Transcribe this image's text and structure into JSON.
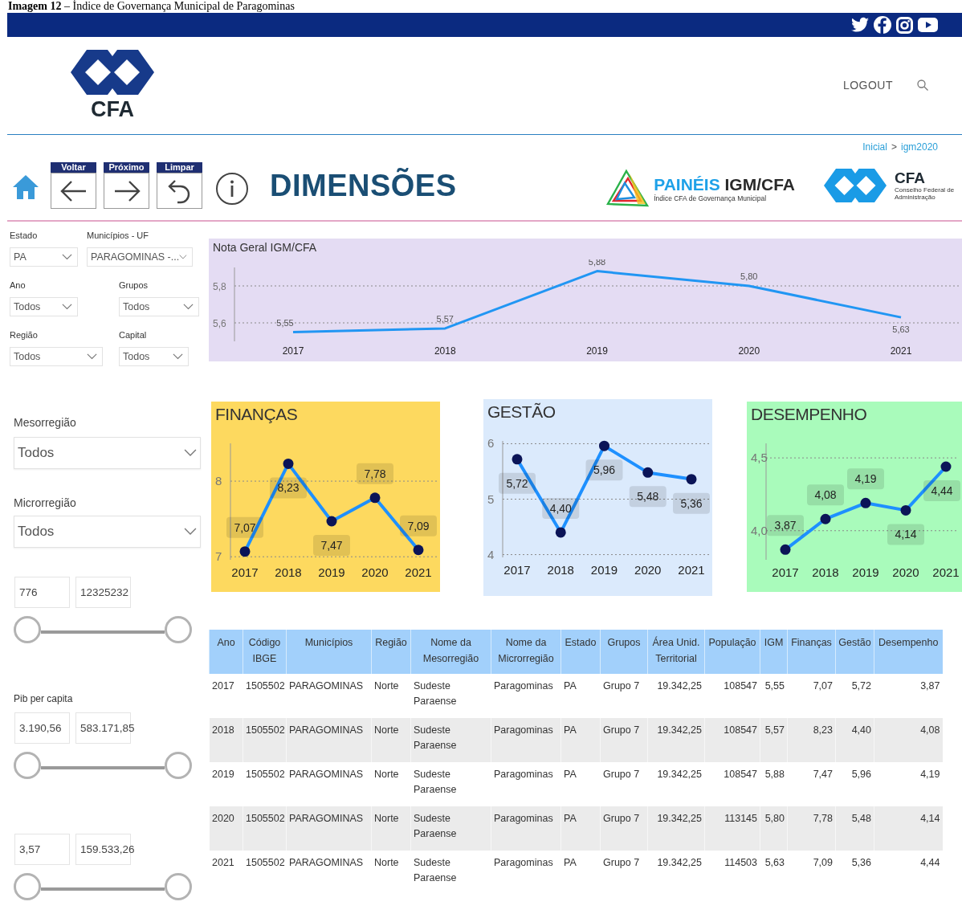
{
  "caption": "**Imagem 12** – Índice de Governança Municipal de Paragominas",
  "header": {
    "logo_text": "CFA",
    "links": [
      "LOGOUT"
    ]
  },
  "breadcrumb": {
    "items": [
      "Inicial",
      "igm2020"
    ],
    "separator": ">"
  },
  "toolbar": {
    "buttons": [
      {
        "label": "Voltar",
        "kind": "back"
      },
      {
        "label": "Próximo",
        "kind": "forward"
      },
      {
        "label": "Limpar",
        "kind": "reset"
      }
    ],
    "title": "DIMENSÕES",
    "brand": {
      "accent": "PAINÉIS",
      "name": "IGM/CFA",
      "subtitle": "Índice CFA de Governança Municipal"
    },
    "org": {
      "name": "CFA",
      "subtitle": "Conselho Federal de Administração"
    }
  },
  "filters": [
    {
      "label": "Estado",
      "value": "PA"
    },
    {
      "label": "Municípios - UF",
      "value": "PARAGOMINAS -..."
    },
    {
      "label": "Ano",
      "value": "Todos"
    },
    {
      "label": "Grupos",
      "value": "Todos"
    },
    {
      "label": "Região",
      "value": "Todos"
    },
    {
      "label": "Capital",
      "value": "Todos"
    }
  ],
  "large_filters": [
    {
      "label": "Mesorregião",
      "value": "Todos"
    },
    {
      "label": "Microrregião",
      "value": "Todos"
    }
  ],
  "ranges": [
    {
      "min": "776",
      "max": "12325232"
    },
    {
      "label": "Pib per capita",
      "min": "3.190,56",
      "max": "583.171,85"
    },
    {
      "min": "3,57",
      "max": "159.533,26"
    }
  ],
  "overall_chart": {
    "title": "Nota Geral IGM/CFA",
    "chart_data": {
      "type": "line",
      "categories": [
        "2017",
        "2018",
        "2019",
        "2020",
        "2021"
      ],
      "values": [
        5.55,
        5.57,
        5.88,
        5.8,
        5.63
      ],
      "ylim": [
        5.5,
        5.9
      ],
      "grid": true,
      "yticks": [
        {
          "value": 5.6,
          "label": "5,6"
        },
        {
          "value": 5.8,
          "label": "5,8"
        }
      ],
      "value_labels": [
        "5,55",
        "5,57",
        "5,88",
        "5,80",
        "5,63"
      ]
    }
  },
  "dimension_charts": [
    {
      "title": "FINANÇAS",
      "color": "#fdd95f",
      "chart_data": {
        "type": "line",
        "categories": [
          "2017",
          "2018",
          "2019",
          "2020",
          "2021"
        ],
        "values": [
          7.07,
          8.23,
          7.47,
          7.78,
          7.09
        ],
        "ylim": [
          6.96,
          8.5
        ],
        "grid": true,
        "marker": true,
        "yticks": [
          {
            "value": 7,
            "label": "7"
          },
          {
            "value": 8,
            "label": "8"
          }
        ],
        "value_labels": [
          "7,07",
          "8,23",
          "7,47",
          "7,78",
          "7,09"
        ]
      }
    },
    {
      "title": "GESTÃO",
      "color": "#dbeafc",
      "chart_data": {
        "type": "line",
        "categories": [
          "2017",
          "2018",
          "2019",
          "2020",
          "2021"
        ],
        "values": [
          5.72,
          4.4,
          5.96,
          5.48,
          5.36
        ],
        "ylim": [
          3.95,
          6.05
        ],
        "grid": true,
        "marker": true,
        "yticks": [
          {
            "value": 4,
            "label": "4"
          },
          {
            "value": 5,
            "label": "5"
          },
          {
            "value": 6,
            "label": "6"
          }
        ],
        "value_labels": [
          "5,72",
          "4,40",
          "5,96",
          "5,48",
          "5,36"
        ]
      }
    },
    {
      "title": "DESEMPENHO",
      "color": "#a9fbbb",
      "chart_data": {
        "type": "line",
        "categories": [
          "2017",
          "2018",
          "2019",
          "2020",
          "2021"
        ],
        "values": [
          3.87,
          4.08,
          4.19,
          4.14,
          4.44
        ],
        "ylim": [
          3.8,
          4.6
        ],
        "grid": true,
        "marker": true,
        "yticks": [
          {
            "value": 4.0,
            "label": "4,0"
          },
          {
            "value": 4.5,
            "label": "4,5"
          }
        ],
        "value_labels": [
          "3,87",
          "4,08",
          "4,19",
          "4,14",
          "4,44"
        ]
      }
    }
  ],
  "table": {
    "columns": [
      "Ano",
      "Código IBGE",
      "Municípios",
      "Região",
      "Nome da Mesorregião",
      "Nome da Microrregião",
      "Estado",
      "Grupos",
      "Área Unid. Territorial",
      "População",
      "IGM",
      "Finanças",
      "Gestão",
      "Desempenho"
    ],
    "rows": [
      [
        "2017",
        "1505502",
        "PARAGOMINAS",
        "Norte",
        "Sudeste Paraense",
        "Paragominas",
        "PA",
        "Grupo 7",
        "19.342,25",
        "108547",
        "5,55",
        "7,07",
        "5,72",
        "3,87"
      ],
      [
        "2018",
        "1505502",
        "PARAGOMINAS",
        "Norte",
        "Sudeste Paraense",
        "Paragominas",
        "PA",
        "Grupo 7",
        "19.342,25",
        "108547",
        "5,57",
        "8,23",
        "4,40",
        "4,08"
      ],
      [
        "2019",
        "1505502",
        "PARAGOMINAS",
        "Norte",
        "Sudeste Paraense",
        "Paragominas",
        "PA",
        "Grupo 7",
        "19.342,25",
        "108547",
        "5,88",
        "7,47",
        "5,96",
        "4,19"
      ],
      [
        "2020",
        "1505502",
        "PARAGOMINAS",
        "Norte",
        "Sudeste Paraense",
        "Paragominas",
        "PA",
        "Grupo 7",
        "19.342,25",
        "113145",
        "5,80",
        "7,78",
        "5,48",
        "4,14"
      ],
      [
        "2021",
        "1505502",
        "PARAGOMINAS",
        "Norte",
        "Sudeste Paraense",
        "Paragominas",
        "PA",
        "Grupo 7",
        "19.342,25",
        "114503",
        "5,63",
        "7,09",
        "5,36",
        "4,44"
      ]
    ]
  }
}
